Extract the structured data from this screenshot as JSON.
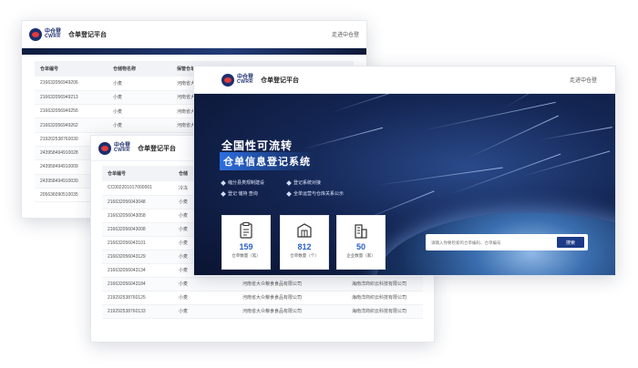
{
  "brand": {
    "cn": "中仓登",
    "en": "CWRR"
  },
  "platform_title": "仓单登记平台",
  "enter_link": "走进中仓登",
  "win1": {
    "headers": [
      "仓单编号",
      "仓储物名称",
      "保管仓单号"
    ],
    "rows": [
      [
        "216632056949206",
        "小麦",
        "河南省大"
      ],
      [
        "216632056949213",
        "小麦",
        "河南省大"
      ],
      [
        "216632056949256",
        "小麦",
        "河南省大"
      ],
      [
        "216632056949262",
        "小麦",
        "河南省大"
      ],
      [
        "219202538760030",
        "",
        ""
      ],
      [
        "243958494910028",
        "",
        ""
      ],
      [
        "243958494910009",
        "",
        ""
      ],
      [
        "243958494910030",
        "",
        ""
      ],
      [
        "205636090510035",
        "",
        ""
      ]
    ]
  },
  "win2": {
    "headers": [
      "仓单编号",
      "仓储"
    ],
    "rows": [
      [
        "CC002201017000001",
        "冷冻",
        "",
        ""
      ],
      [
        "216632056043048",
        "小麦",
        "",
        ""
      ],
      [
        "216632056043058",
        "小麦",
        "",
        ""
      ],
      [
        "216632056043008",
        "小麦",
        "",
        ""
      ],
      [
        "216632056043101",
        "小麦",
        "",
        ""
      ],
      [
        "216632056043129",
        "小麦",
        "",
        ""
      ],
      [
        "216632056043134",
        "小麦",
        "河南省大众粮食食品有限公司",
        "海南洋商织云科技有限公司"
      ],
      [
        "216632056043184",
        "小麦",
        "河南省大众粮食食品有限公司",
        "海南洋商织云科技有限公司"
      ],
      [
        "219292538760125",
        "小麦",
        "河南省大众粮食食品有限公司",
        "海南洋商织云科技有限公司"
      ],
      [
        "219292538760133",
        "小麦",
        "河南省大众粮食食品有限公司",
        "海南洋商织云科技有限公司"
      ]
    ]
  },
  "hero": {
    "title1": "全国性可流转",
    "title2": "仓单信息登记系统",
    "features": [
      "缩分县类规制建设",
      "登记 储持 查询",
      "登记系统对接",
      "全单运营与仓库关系公示"
    ]
  },
  "stats": [
    {
      "value": "159",
      "label": "仓单数量（笔）",
      "icon": "document-icon"
    },
    {
      "value": "812",
      "label": "仓单数量（个）",
      "icon": "warehouse-box-icon"
    },
    {
      "value": "50",
      "label": "企业数量（家）",
      "icon": "building-icon"
    }
  ],
  "search": {
    "placeholder": "请输入你要检索的仓单编码、仓单编号",
    "button": "搜索"
  }
}
